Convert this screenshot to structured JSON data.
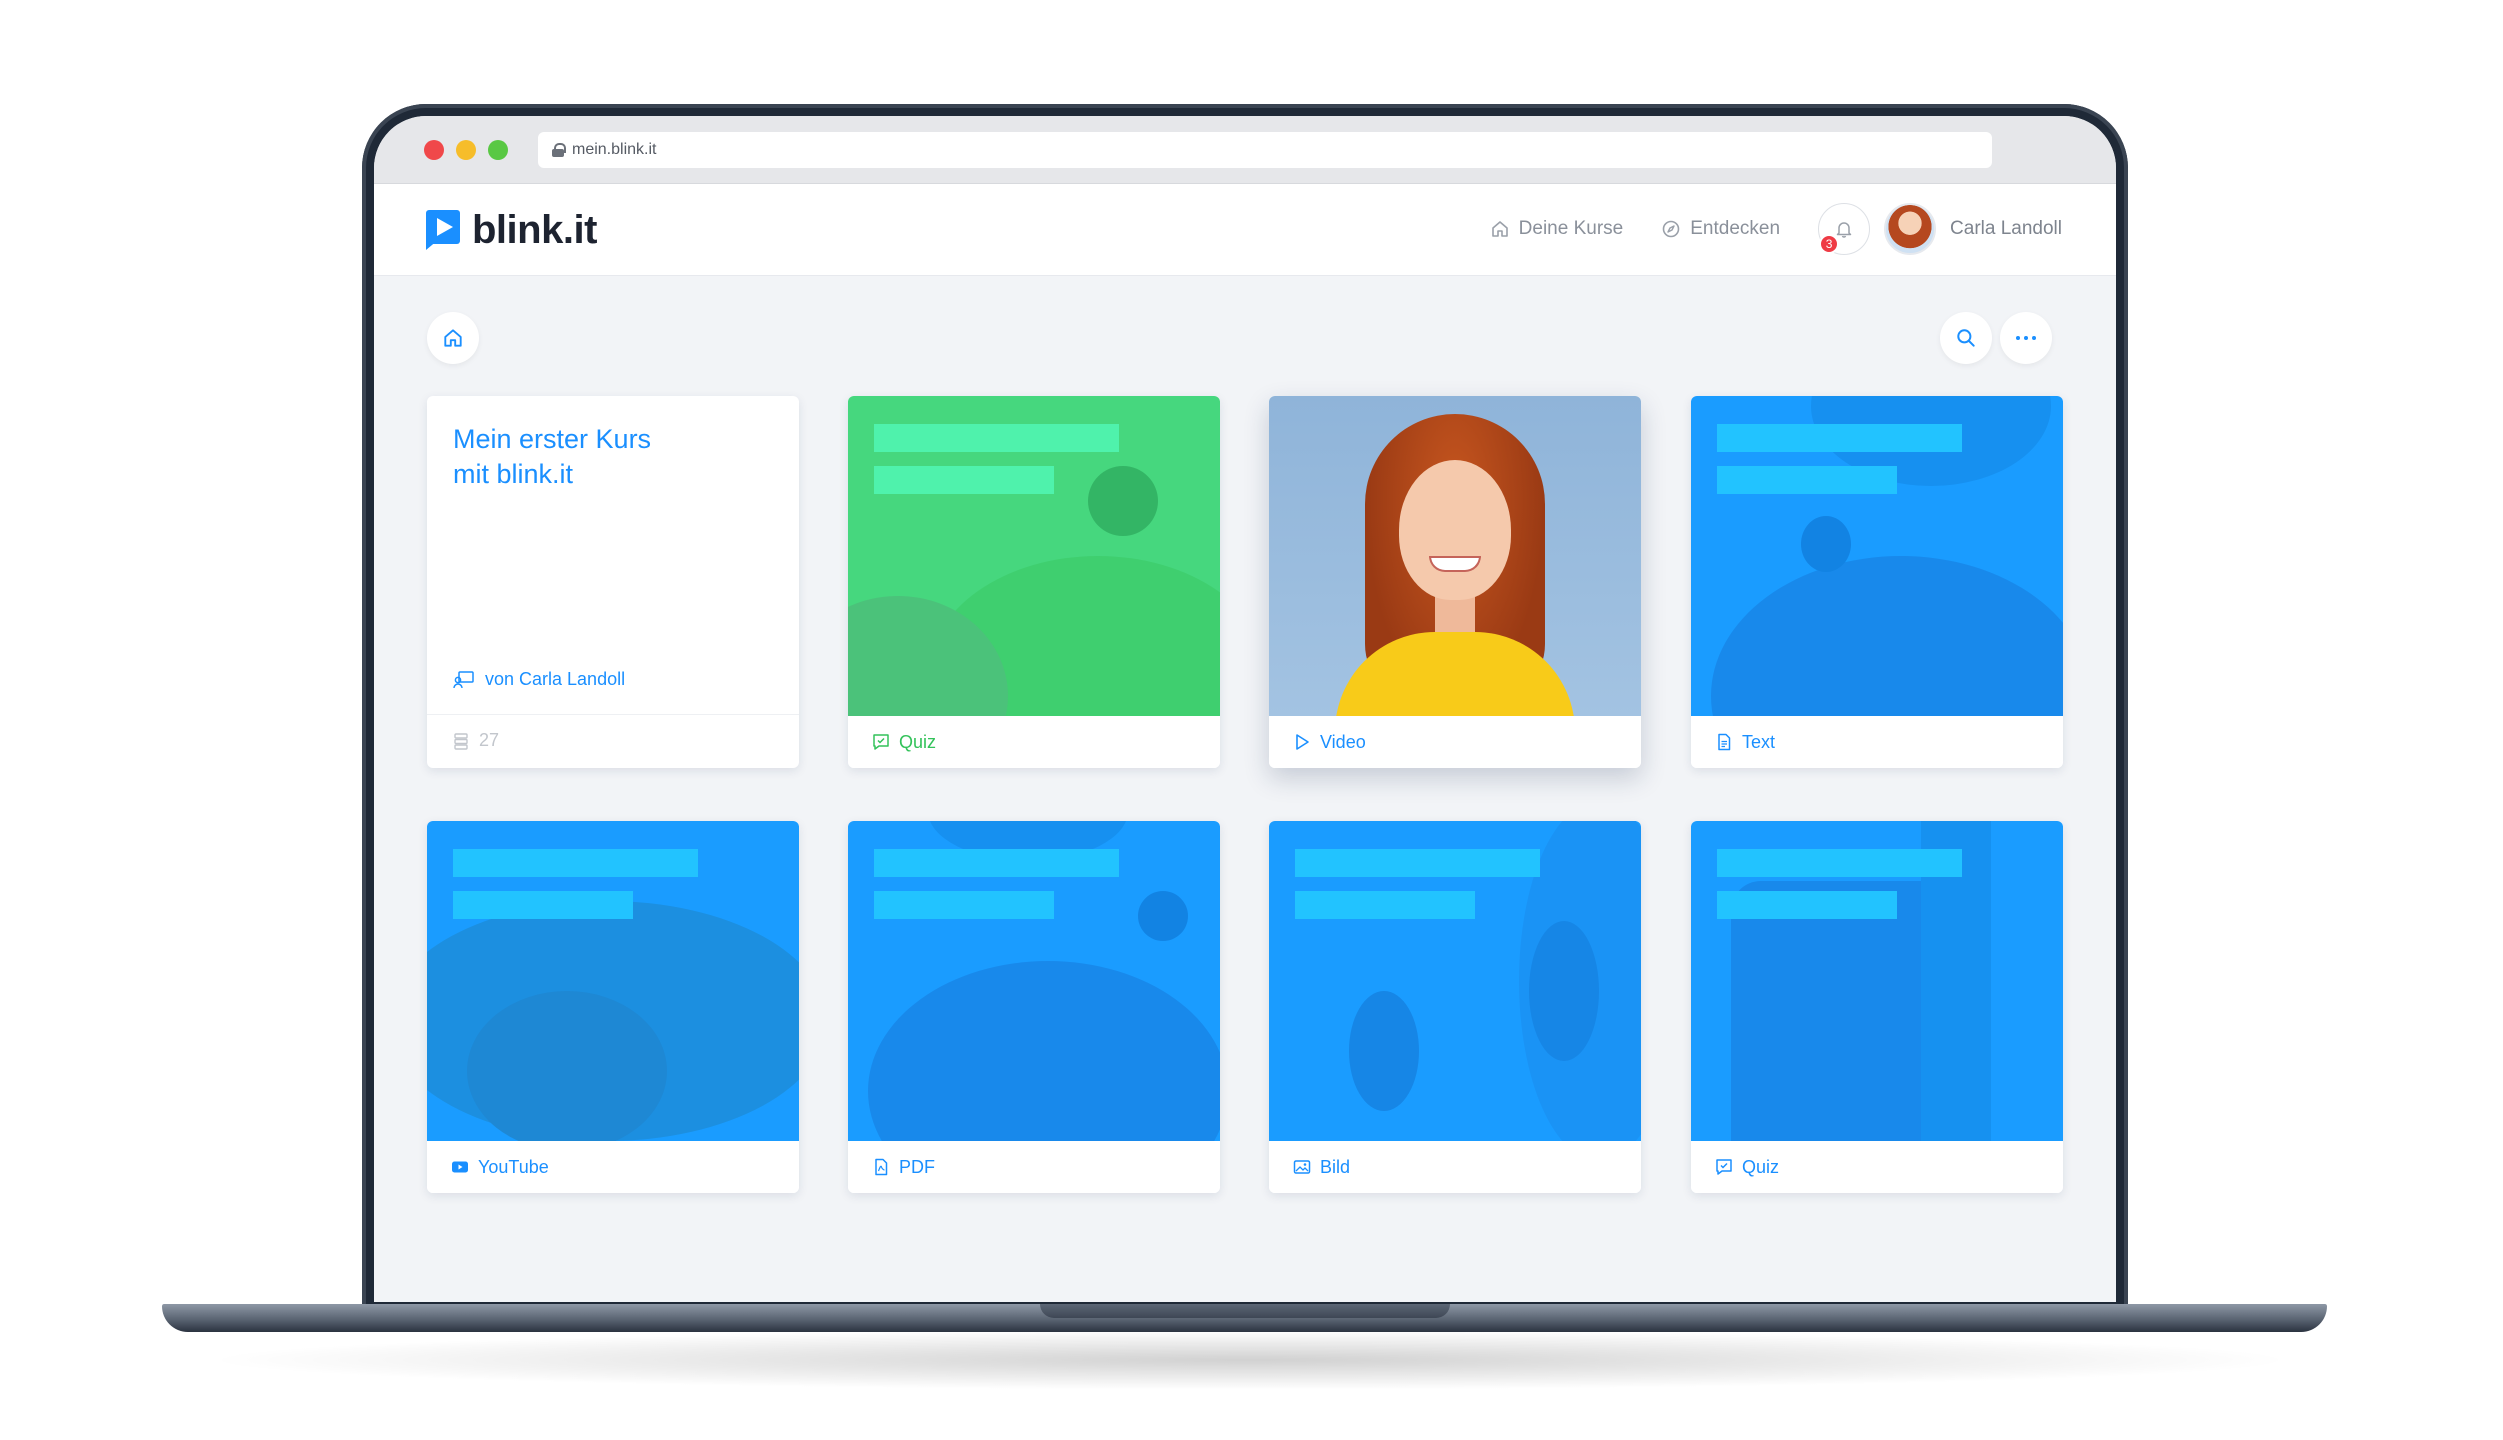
{
  "browser": {
    "url": "mein.blink.it"
  },
  "header": {
    "logo_text": "blink.it",
    "nav": [
      {
        "label": "Deine Kurse",
        "icon": "home-icon"
      },
      {
        "label": "Entdecken",
        "icon": "compass-icon"
      }
    ],
    "notifications_count": "3",
    "user_name": "Carla Landoll"
  },
  "toolbar": {
    "home_icon": "home-icon",
    "search_icon": "search-icon",
    "more_icon": "more-icon"
  },
  "course": {
    "title_line1": "Mein erster Kurs",
    "title_line2": "mit blink.it",
    "author": "von Carla Landoll",
    "count": "27"
  },
  "cards": [
    {
      "label": "Quiz",
      "icon": "quiz-icon",
      "color": "#33c25a"
    },
    {
      "label": "Video",
      "icon": "play-icon",
      "color": "#1a8fff"
    },
    {
      "label": "Text",
      "icon": "document-icon",
      "color": "#1a8fff"
    },
    {
      "label": "YouTube",
      "icon": "youtube-icon",
      "color": "#1a8fff"
    },
    {
      "label": "PDF",
      "icon": "pdf-icon",
      "color": "#1a8fff"
    },
    {
      "label": "Bild",
      "icon": "image-icon",
      "color": "#1a8fff"
    },
    {
      "label": "Quiz",
      "icon": "quiz-icon",
      "color": "#1a8fff"
    }
  ],
  "colors": {
    "accent": "#1a8fff",
    "green": "#46d77e",
    "blue_tile": "#1a9cff",
    "badge": "#ef3b45"
  }
}
